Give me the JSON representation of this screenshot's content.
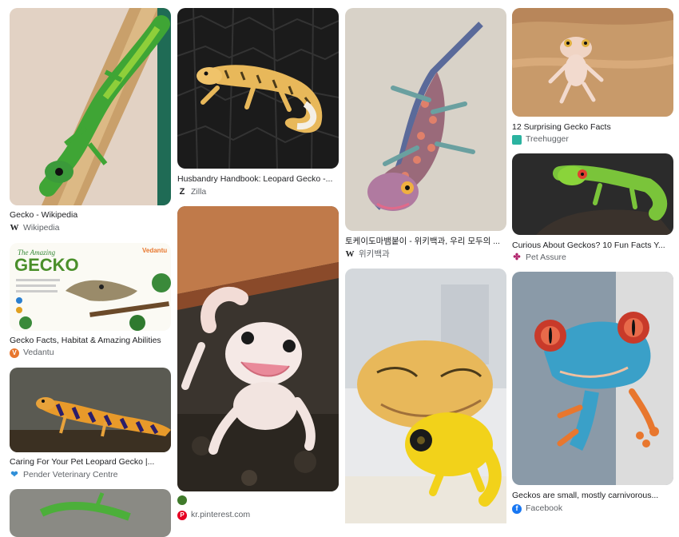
{
  "results": [
    {
      "title": "Gecko - Wikipedia",
      "source": "Wikipedia",
      "icon": "wikipedia-icon"
    },
    {
      "title": "Gecko Facts, Habitat & Amazing Abilities",
      "source": "Vedantu",
      "icon": "vedantu-icon"
    },
    {
      "title": "Caring For Your Pet Leopard Gecko |...",
      "source": "Pender Veterinary Centre",
      "icon": "pender-icon"
    },
    {
      "title": "Husbandry Handbook: Leopard Gecko -...",
      "source": "Zilla",
      "icon": "zilla-icon"
    },
    {
      "title": "",
      "source": "kr.pinterest.com",
      "icon": "pinterest-icon"
    },
    {
      "title": "토케이도마뱀붙이 - 위키백과, 우리 모두의 ...",
      "source": "위키백과",
      "icon": "wikipedia-icon"
    },
    {
      "title": "12 Surprising Gecko Facts",
      "source": "Treehugger",
      "icon": "treehugger-icon"
    },
    {
      "title": "Curious About Geckos? 10 Fun Facts Y...",
      "source": "Pet Assure",
      "icon": "pet-assure-icon"
    },
    {
      "title": "Geckos are small, mostly carnivorous...",
      "source": "Facebook",
      "icon": "facebook-icon"
    }
  ],
  "image_text": {
    "vedantu_heading_top": "The Amazing",
    "vedantu_heading": "GECKO",
    "vedantu_brand": "Vedantu"
  },
  "colors": {
    "title_text": "#202124",
    "source_text": "#5f6368",
    "page_background": "#ffffff"
  }
}
